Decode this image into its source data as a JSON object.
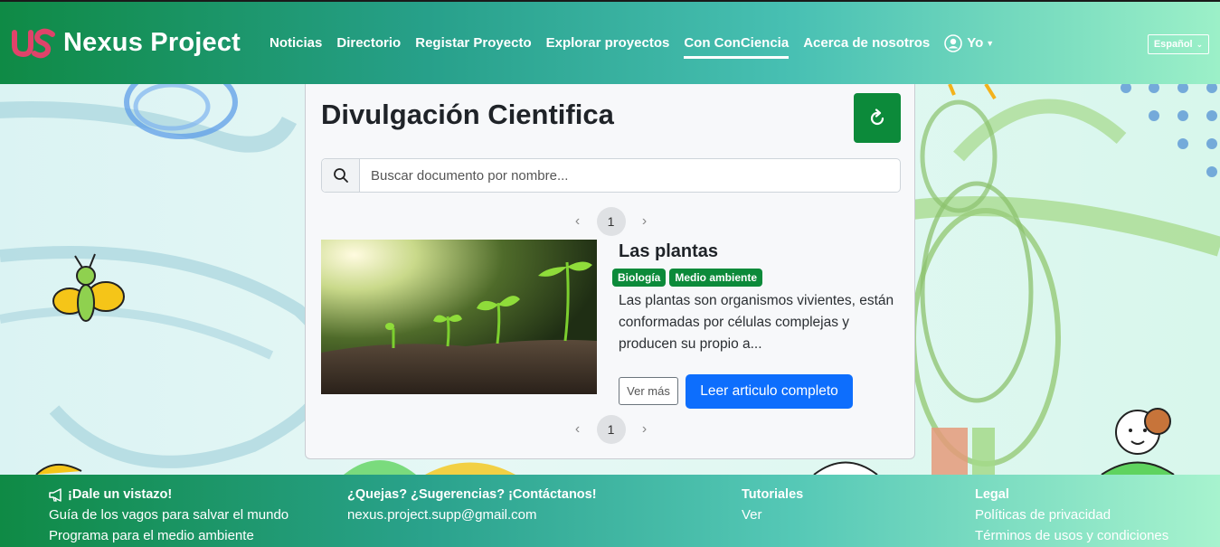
{
  "navbar": {
    "brand": "Nexus Project",
    "items": [
      {
        "label": "Noticias",
        "active": false
      },
      {
        "label": "Directorio",
        "active": false
      },
      {
        "label": "Registar Proyecto",
        "active": false
      },
      {
        "label": "Explorar proyectos",
        "active": false
      },
      {
        "label": "Con ConCiencia",
        "active": true
      },
      {
        "label": "Acerca de nosotros",
        "active": false
      }
    ],
    "user_label": "Yo",
    "language": "Español"
  },
  "main": {
    "title": "Divulgación Cientifica",
    "search_placeholder": "Buscar documento por nombre...",
    "current_page": "1",
    "article": {
      "title": "Las plantas",
      "tags": [
        "Biología",
        "Medio ambiente"
      ],
      "description": "Las plantas son organismos vivientes, están conformadas por células complejas y producen su propio a...",
      "more_label": "Ver más",
      "read_label": "Leer articulo completo"
    }
  },
  "footer": {
    "col1": {
      "heading": "¡Dale un vistazo!",
      "links": [
        "Guía de los vagos para salvar el mundo",
        "Programa para el medio ambiente"
      ]
    },
    "col2": {
      "heading": "¿Quejas? ¿Sugerencias? ¡Contáctanos!",
      "links": [
        "nexus.project.supp@gmail.com"
      ]
    },
    "col3": {
      "heading": "Tutoriales",
      "links": [
        "Ver"
      ]
    },
    "col4": {
      "heading": "Legal",
      "links": [
        "Políticas de privacidad",
        "Términos de usos y condiciones"
      ]
    }
  },
  "colors": {
    "primary": "#0d6efd",
    "brand_green": "#0c8a3a",
    "logo_pink": "#e0436a"
  }
}
